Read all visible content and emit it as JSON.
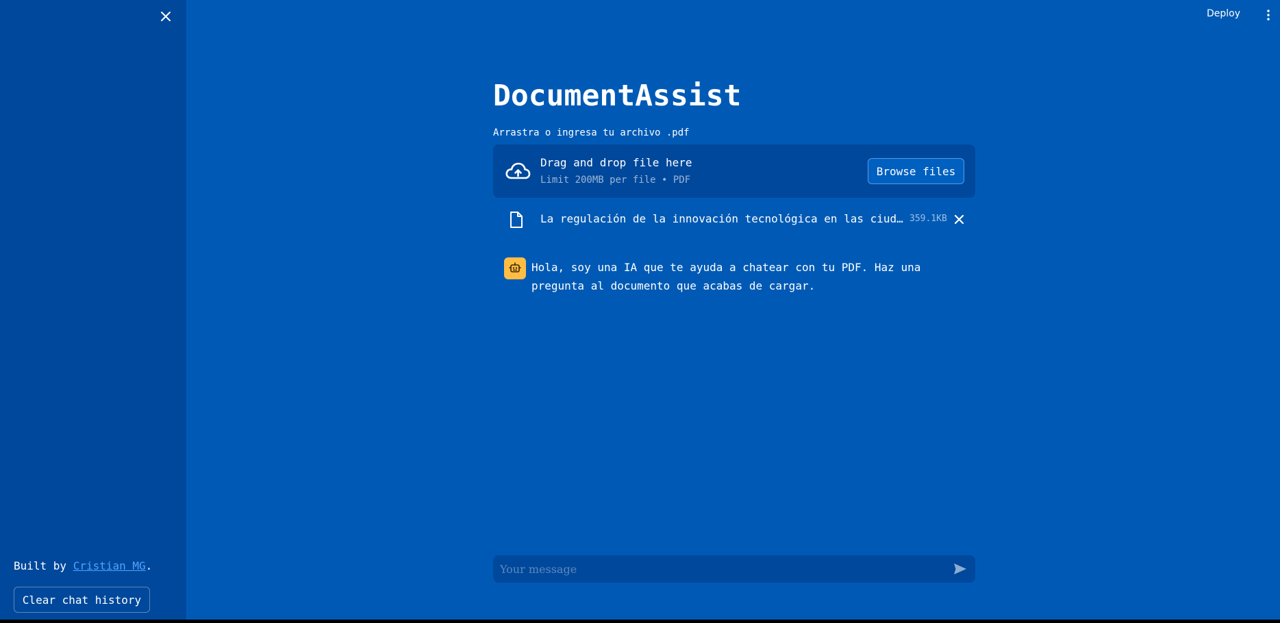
{
  "app": {
    "title": "DocumentAssist",
    "toolbar": {
      "deploy_label": "Deploy",
      "menu_icon": "vertical-dots-icon"
    }
  },
  "sidebar": {
    "close_icon": "close-icon",
    "built_by_prefix": "Built by ",
    "built_by_link": "Cristian MG",
    "built_by_suffix": ".",
    "clear_button_label": "Clear chat history"
  },
  "uploader": {
    "label": "Arrastra o ingresa tu archivo .pdf",
    "drop_title": "Drag and drop file here",
    "drop_subtitle": "Limit 200MB per file • PDF",
    "browse_label": "Browse files",
    "icon": "cloud-upload-icon"
  },
  "uploaded_file": {
    "name": "La regulación de la innovación tecnológica en las ciudades inteligentes.pdf",
    "size": "359.1KB",
    "icon": "file-icon",
    "remove_icon": "close-icon"
  },
  "chat": {
    "messages": [
      {
        "role": "assistant",
        "avatar_icon": "robot-icon",
        "text": "Hola, soy una IA que te ayuda a chatear con tu PDF. Haz una pregunta al documento que acabas de cargar."
      }
    ],
    "input": {
      "value": "",
      "placeholder": "Your message"
    },
    "send_icon": "send-icon"
  },
  "colors": {
    "main_bg": "#005ab5",
    "sidebar_bg": "#00489c",
    "avatar_bg": "#ffbd45",
    "link": "#4fa3ff"
  }
}
